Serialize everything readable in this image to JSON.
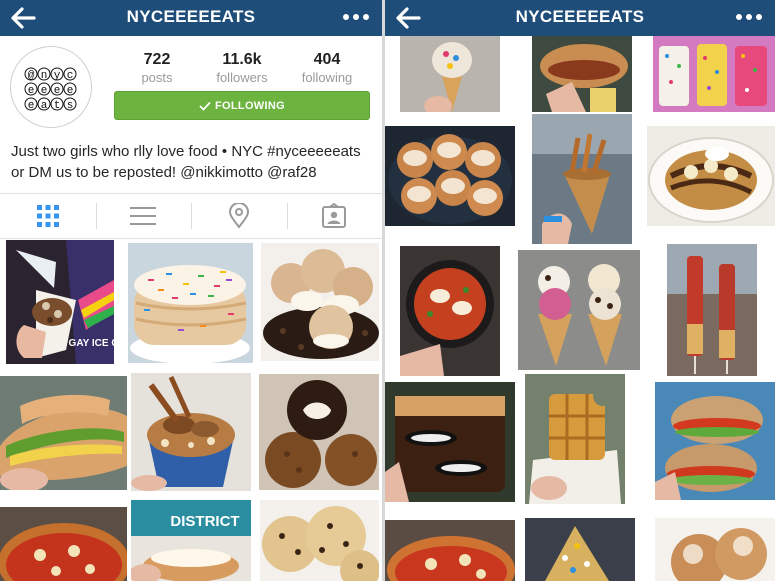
{
  "profile_screen": {
    "title": "NYCEEEEEATS",
    "avatar_lines": [
      "@nyc",
      "eeee",
      "eats"
    ],
    "stats": [
      {
        "value": "722",
        "label": "posts"
      },
      {
        "value": "11.6k",
        "label": "followers"
      },
      {
        "value": "404",
        "label": "following"
      }
    ],
    "follow_button": "FOLLOWING",
    "bio": "Just two girls who rlly love food • NYC #nyceeeeeats or DM us to be reposted! @nikkimotto @raf28",
    "tabs": [
      "grid-view",
      "list-view",
      "location-view",
      "tagged-view"
    ]
  },
  "feed_screen": {
    "title": "NYCEEEEEATS"
  },
  "colors": {
    "navbar": "#1f4d7a",
    "follow_green": "#6cb33f",
    "active_tab": "#3897f0"
  },
  "photos": {
    "left_grid": [
      "big gay ice cream cone",
      "funfetti pancakes",
      "cream puffs with chocolate",
      "stuffed sandwich",
      "pretzel topped ice cream cup",
      "fried oreo balls",
      "pizza",
      "district sandwich",
      "cookie dough"
    ],
    "right_grid": [
      "cereal ice cream cone",
      "sandwich roll",
      "sprinkled dessert bars",
      "glazed cinnamon buns",
      "churro fries cone",
      "banana nutella waffle",
      "shakshuka skillet",
      "two ice cream cones",
      "waffle skewers",
      "oreo brownies",
      "bitten waffle",
      "blt bagels",
      "pizza slice",
      "sugared donut",
      "powdered donuts"
    ]
  },
  "grid_lettering": {
    "photo_1": "BIG GAY ICE CREAM",
    "photo_8": "DISTRICT"
  }
}
